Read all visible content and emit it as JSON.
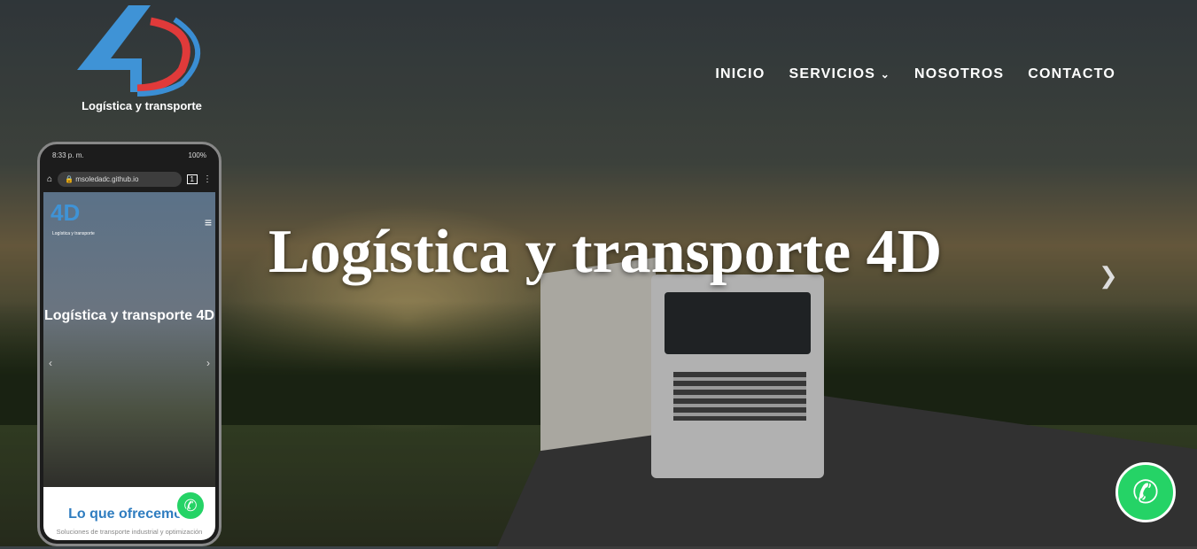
{
  "logo": {
    "text": "Logística y transporte"
  },
  "nav": [
    {
      "label": "INICIO"
    },
    {
      "label": "SERVICIOS"
    },
    {
      "label": "NOSOTROS"
    },
    {
      "label": "CONTACTO"
    }
  ],
  "hero": {
    "title": "Logística y transporte 4D"
  },
  "phone": {
    "time": "8:33 p. m.",
    "battery": "100%",
    "url": "msoledadc.github.io",
    "tabs": "1",
    "logo_text": "Logística y transporte",
    "hero_title": "Logística y transporte 4D",
    "section_title": "Lo que ofrecemos",
    "section_subtitle": "Soluciones de transporte industrial y optimización"
  }
}
